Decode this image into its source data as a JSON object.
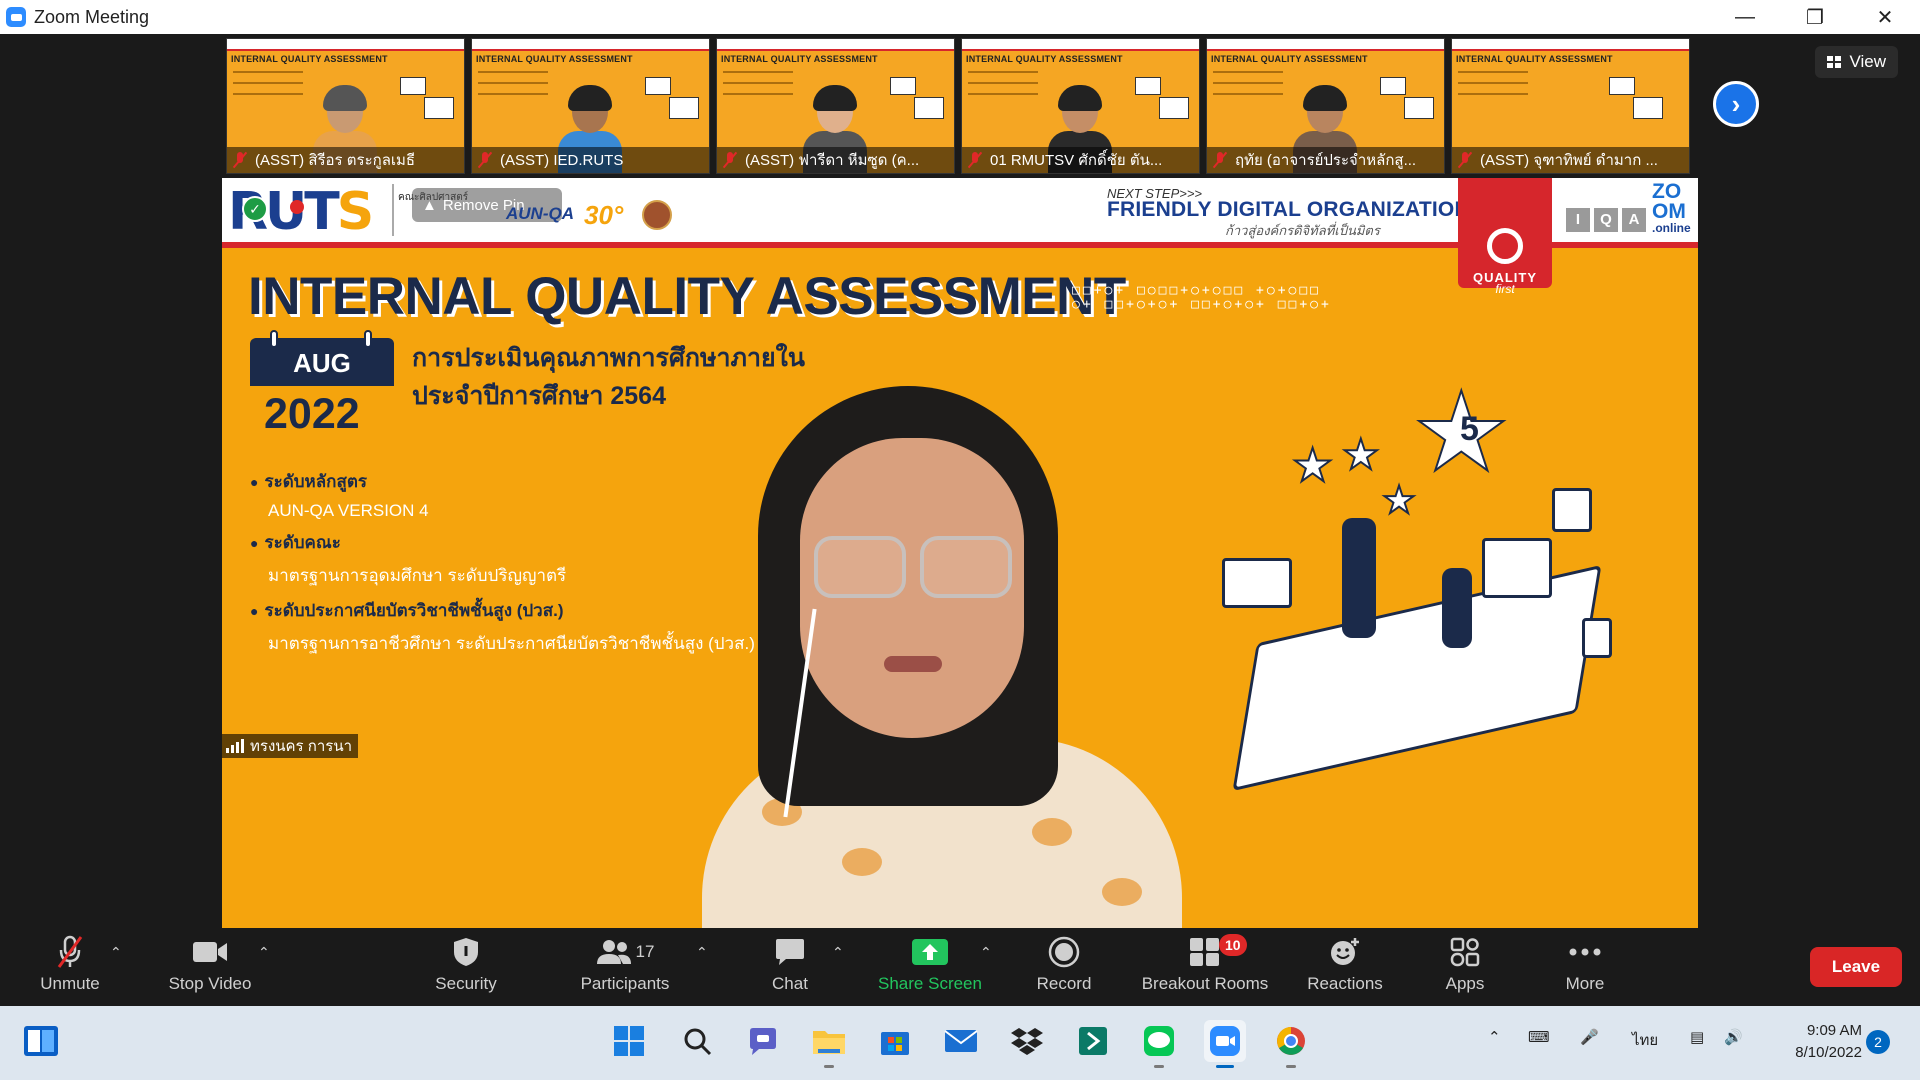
{
  "window": {
    "title": "Zoom Meeting",
    "controls": [
      "minimize",
      "restore",
      "close"
    ]
  },
  "meeting": {
    "view_label": "View",
    "thumbnails": [
      {
        "name": "(ASST) สิรีอร ตระกูลเมธี",
        "muted": true
      },
      {
        "name": "(ASST) IED.RUTS",
        "muted": true
      },
      {
        "name": "(ASST) ฟารีดา หีมซูด (ค...",
        "muted": true
      },
      {
        "name": "01 RMUTSV ศักดิ์ชัย ตัน...",
        "muted": true
      },
      {
        "name": "ฤทัย (อาจารย์ประจำหลักสู...",
        "muted": true
      },
      {
        "name": "(ASST) จุฑาทิพย์ ดำมาก ...",
        "muted": true
      }
    ],
    "thumbnail_heading": "INTERNAL QUALITY ASSESSMENT",
    "next_page_icon": "chevron-right-icon",
    "active_speaker": "ทรงนคร การนา",
    "focus_chip_label": "Remove Pin"
  },
  "slide": {
    "banner": {
      "next_step": "NEXT STEP>>>",
      "friendly": "FRIENDLY DIGITAL ORGANIZATION",
      "friendly_th": "ก้าวสู่องค์กรดิจิทัลที่เป็นมิตร",
      "faculty": "คณะศิลปศาสตร์",
      "aunqa": "AUN-QA",
      "zoom_logo_top": "ZO",
      "zoom_logo_mid": "OM",
      "zoom_logo_bottom": ".online",
      "iqa_letters": [
        "I",
        "Q",
        "A"
      ]
    },
    "quality_label": "QUALITY",
    "first_label": "first",
    "title": "INTERNAL QUALITY ASSESSMENT",
    "month": "AUG",
    "year": "2022",
    "thai_title_1": "การประเมินคุณภาพการศึกษาภายใน",
    "thai_title_2": "ประจำปีการศึกษา 2564",
    "bullets": [
      {
        "label": "ระดับหลักสูตร",
        "sub": "AUN-QA VERSION 4"
      },
      {
        "label": "ระดับคณะ",
        "sub": "มาตรฐานการอุดมศึกษา ระดับปริญญาตรี"
      },
      {
        "label": "ระดับประกาศนียบัตรวิชาชีพชั้นสูง (ปวส.)",
        "sub": "มาตรฐานการอาชีวศึกษา ระดับประกาศนียบัตรวิชาชีพชั้นสูง (ปวส.)"
      }
    ],
    "star_number": "5",
    "colors": {
      "background": "#f5a40d",
      "navy": "#1b2a4a",
      "red": "#d6262c"
    }
  },
  "toolbar": {
    "unmute": "Unmute",
    "stop_video": "Stop Video",
    "security": "Security",
    "participants": "Participants",
    "participants_count": "17",
    "chat": "Chat",
    "share_screen": "Share Screen",
    "record": "Record",
    "breakout_rooms": "Breakout Rooms",
    "breakout_count": "10",
    "reactions": "Reactions",
    "apps": "Apps",
    "more": "More",
    "leave": "Leave",
    "colors": {
      "share": "#22c55e",
      "leave": "#d92626"
    }
  },
  "taskbar": {
    "language": "ไทย",
    "time": "9:09 AM",
    "date": "8/10/2022",
    "notifications": "2"
  }
}
